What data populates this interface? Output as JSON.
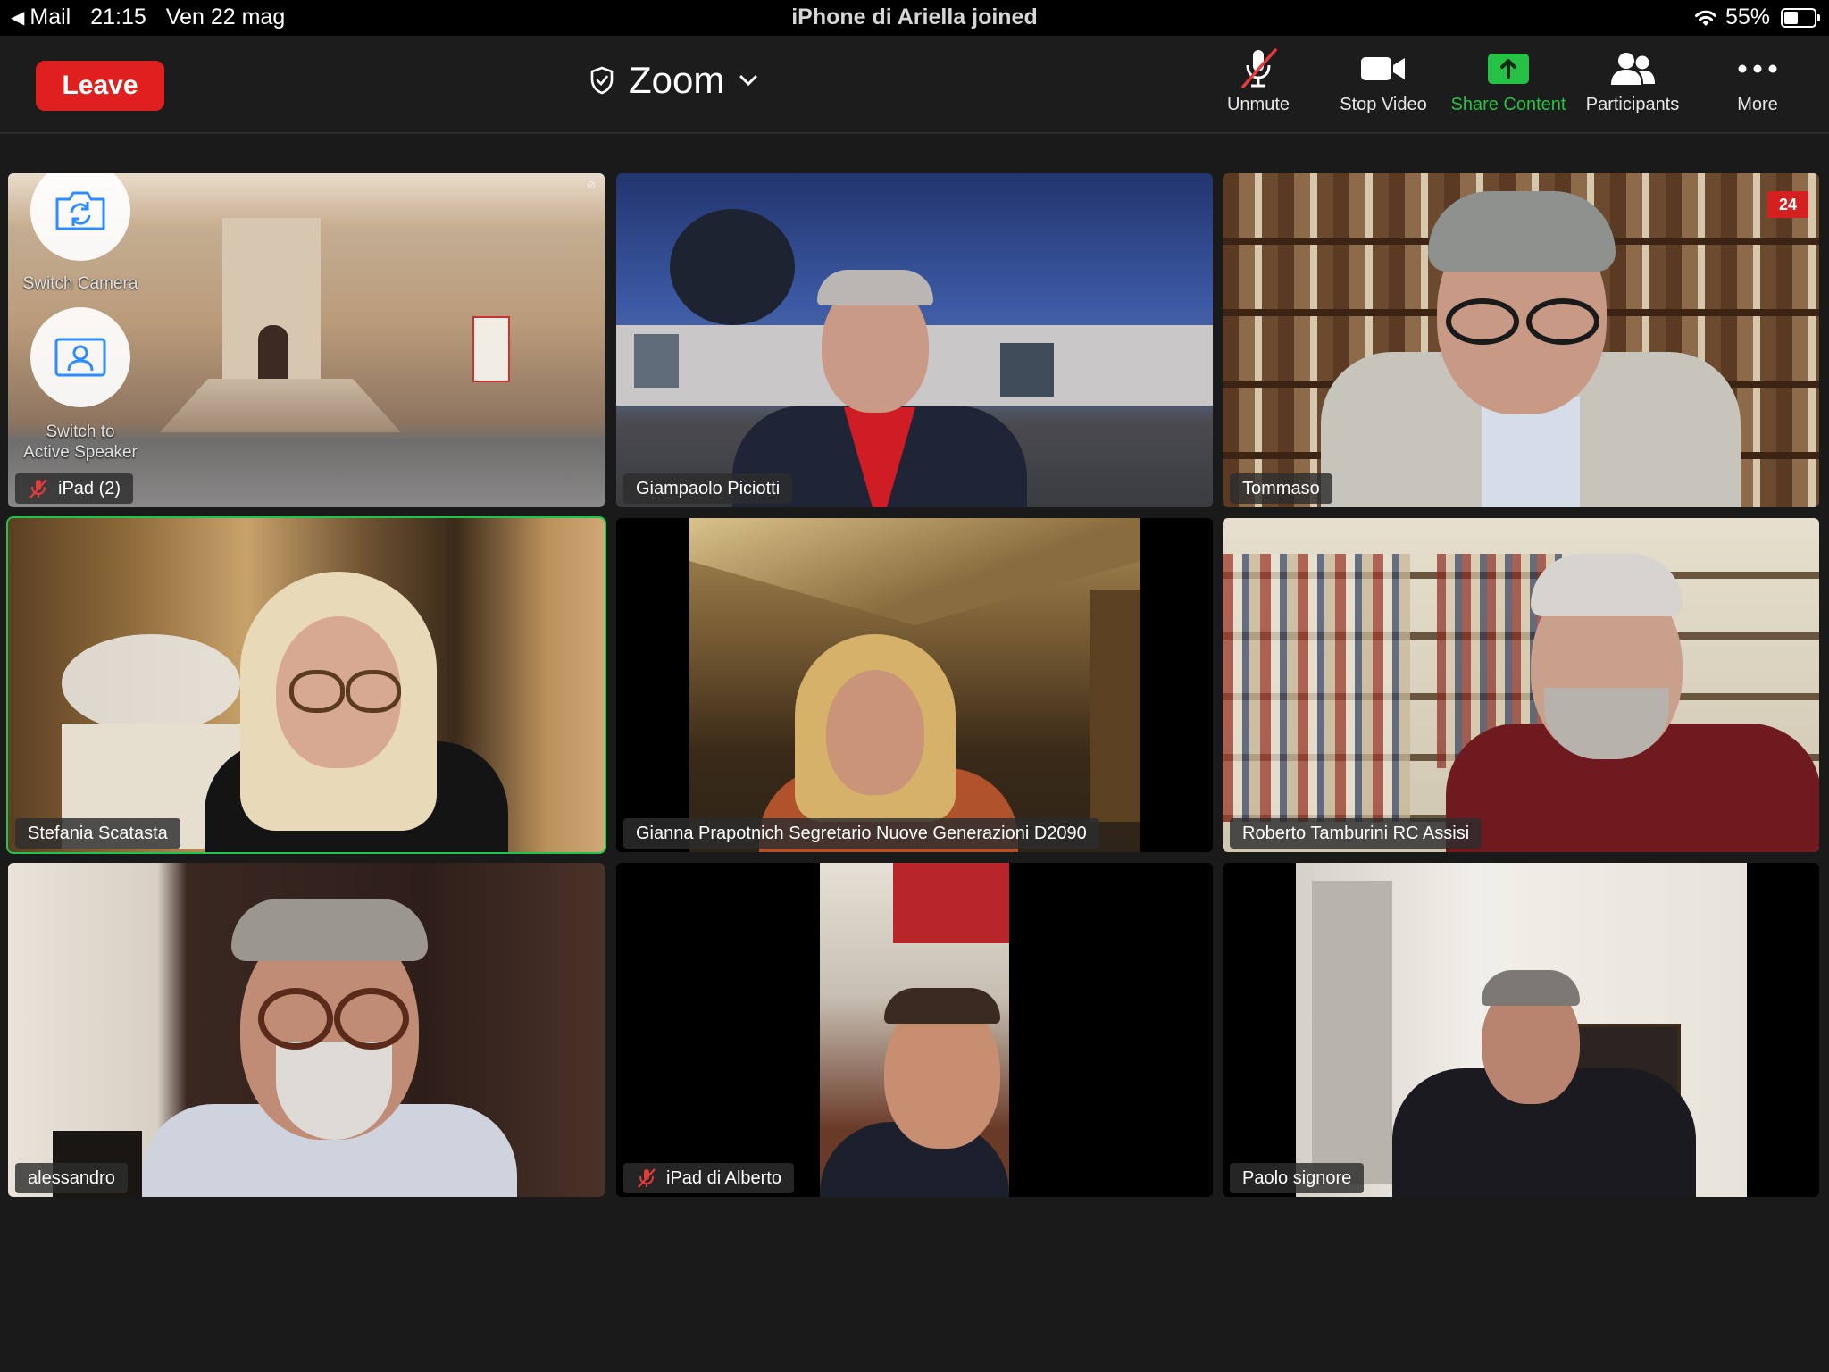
{
  "status_bar": {
    "back_app": "Mail",
    "time": "21:15",
    "date": "Ven 22 mag",
    "notification": "iPhone di Ariella joined",
    "battery_percent": "55%",
    "battery_level": 0.55
  },
  "toolbar": {
    "leave_label": "Leave",
    "title": "Zoom",
    "buttons": [
      {
        "label": "Unmute",
        "icon": "mic-muted-icon"
      },
      {
        "label": "Stop Video",
        "icon": "video-camera-icon"
      },
      {
        "label": "Share Content",
        "icon": "share-screen-icon"
      },
      {
        "label": "Participants",
        "icon": "participants-icon"
      },
      {
        "label": "More",
        "icon": "more-dots-icon"
      }
    ]
  },
  "camera_controls": {
    "switch_camera_label": "Switch Camera",
    "switch_speaker_label_1": "Switch to",
    "switch_speaker_label_2": "Active Speaker"
  },
  "participants": [
    {
      "name": "iPad (2)",
      "muted": true
    },
    {
      "name": "Giampaolo Piciotti",
      "muted": false
    },
    {
      "name": "Tommaso",
      "muted": false
    },
    {
      "name": "Stefania Scatasta",
      "muted": false,
      "active_speaker": true
    },
    {
      "name": "Gianna Prapotnich Segretario Nuove Generazioni   D2090",
      "muted": false
    },
    {
      "name": "Roberto Tamburini RC Assisi",
      "muted": false
    },
    {
      "name": "alessandro",
      "muted": false
    },
    {
      "name": "iPad di Alberto",
      "muted": true
    },
    {
      "name": "Paolo signore",
      "muted": false
    }
  ],
  "colors": {
    "leave": "#e0201f",
    "share_green": "#25c245",
    "active_border": "#21c24e",
    "mute_red": "#e53b3b"
  }
}
